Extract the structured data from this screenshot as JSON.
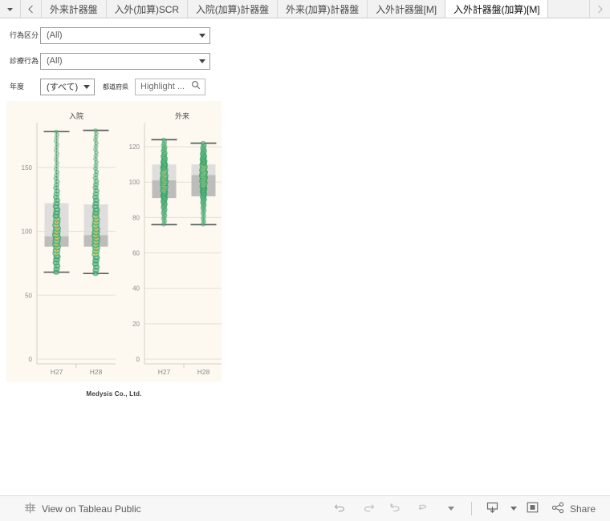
{
  "tabbar": {
    "menu_icon": "caret-down-icon",
    "prev_icon": "chevron-left-icon",
    "next_icon": "chevron-right-icon",
    "tabs": [
      {
        "label": "外来計器盤",
        "active": false
      },
      {
        "label": "入外(加算)SCR",
        "active": false
      },
      {
        "label": "入院(加算)計器盤",
        "active": false
      },
      {
        "label": "外来(加算)計器盤",
        "active": false
      },
      {
        "label": "入外計器盤[M]",
        "active": false
      },
      {
        "label": "入外計器盤(加算)[M]",
        "active": true
      }
    ]
  },
  "filters": {
    "rows": [
      {
        "label": "行為区分",
        "value": "(All)",
        "type": "dropdown"
      },
      {
        "label": "診療行為",
        "value": "(All)",
        "type": "dropdown"
      }
    ],
    "year": {
      "label": "年度",
      "value": "(すべて)"
    },
    "prefecture": {
      "label": "都道府県",
      "placeholder": "Highlight ...",
      "icon": "search-icon"
    }
  },
  "viz": {
    "caption": "Medysis Co., Ltd.",
    "background": "#fdf8f0"
  },
  "chart_data": {
    "type": "box",
    "title": "",
    "panels": [
      {
        "name": "入院",
        "ylabel": "",
        "ylim": [
          0,
          180
        ],
        "yticks": [
          0,
          50,
          100,
          150
        ],
        "categories": [
          "H27",
          "H28"
        ],
        "grid": true,
        "boxes": [
          {
            "category": "H27",
            "min": 68,
            "q1": 88,
            "median": 96,
            "q3": 122,
            "max": 178
          },
          {
            "category": "H28",
            "min": 67,
            "q1": 88,
            "median": 97,
            "q3": 121,
            "max": 179
          }
        ]
      },
      {
        "name": "外来",
        "ylabel": "",
        "ylim": [
          0,
          130
        ],
        "yticks": [
          0,
          20,
          40,
          60,
          80,
          100,
          120
        ],
        "categories": [
          "H27",
          "H28"
        ],
        "grid": true,
        "boxes": [
          {
            "category": "H27",
            "min": 76,
            "q1": 91,
            "median": 101,
            "q3": 110,
            "max": 124
          },
          {
            "category": "H28",
            "min": 76,
            "q1": 92,
            "median": 104,
            "q3": 110,
            "max": 122
          }
        ]
      }
    ],
    "marks": "density-jitter-points",
    "colors": {
      "box_upper": "#d9d9d9",
      "box_lower": "#b3b3b3",
      "whisker": "#666666",
      "point_outer": "#239b56",
      "point_inner": "#f4d03f",
      "point_core": "#e8590c"
    }
  },
  "toolbar": {
    "view_public_label": "View on Tableau Public",
    "tableau_icon": "tableau-logo-icon",
    "undo_icon": "undo-icon",
    "redo_icon": "redo-icon",
    "revert_icon": "revert-icon",
    "refresh_icon": "refresh-icon",
    "pause_caret_icon": "caret-down-icon",
    "download_icon": "download-icon",
    "download_caret_icon": "caret-down-icon",
    "fullscreen_icon": "fullscreen-icon",
    "share_icon": "share-icon",
    "share_label": "Share"
  }
}
